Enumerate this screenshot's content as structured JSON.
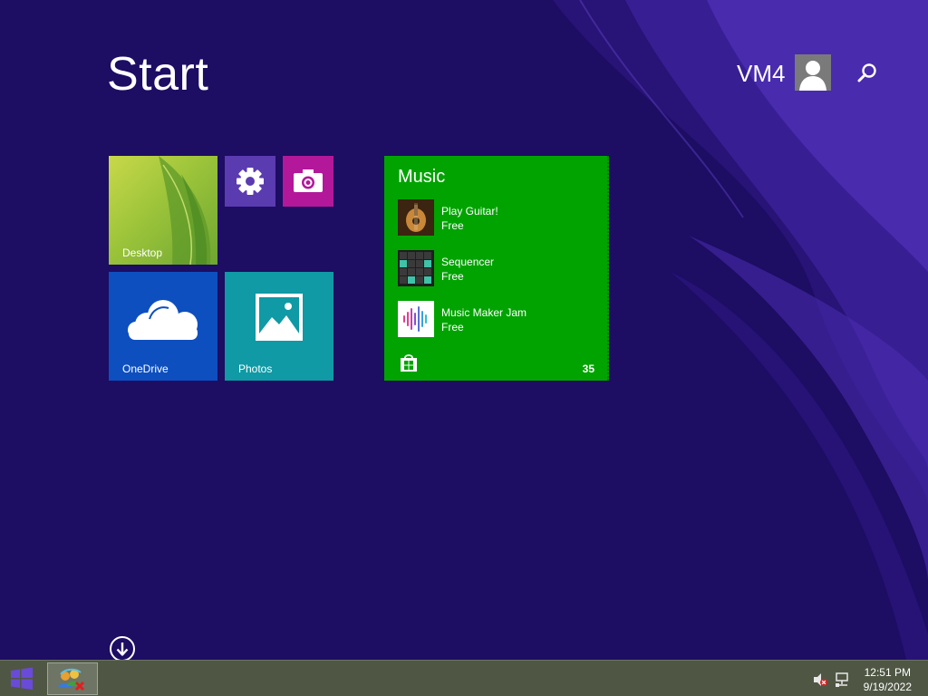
{
  "start": {
    "title": "Start"
  },
  "user": {
    "name": "VM4",
    "avatar_icon": "user-avatar-icon"
  },
  "search": {
    "icon": "search-icon"
  },
  "tiles": {
    "desktop": {
      "label": "Desktop"
    },
    "settings": {
      "icon": "gear-icon"
    },
    "camera": {
      "icon": "camera-icon"
    },
    "onedrive": {
      "label": "OneDrive",
      "icon": "cloud-icon"
    },
    "photos": {
      "label": "Photos",
      "icon": "photo-icon"
    },
    "music": {
      "title": "Music",
      "items": [
        {
          "name": "Play Guitar!",
          "price": "Free"
        },
        {
          "name": "Sequencer",
          "price": "Free"
        },
        {
          "name": "Music Maker Jam",
          "price": "Free"
        }
      ],
      "count": "35",
      "store_icon": "store-icon"
    }
  },
  "all_apps": {
    "icon": "arrow-down-circle-icon"
  },
  "taskbar": {
    "start_icon": "windows-logo-icon",
    "app_icon": "network-users-icon",
    "tray": {
      "volume_icon": "volume-muted-icon",
      "network_icon": "network-icon"
    },
    "clock": {
      "time": "12:51 PM",
      "date": "9/19/2022"
    }
  },
  "colors": {
    "background": "#1d0d63",
    "tile_music": "#00a300",
    "tile_onedrive": "#0d4fbf",
    "tile_photos": "#0f9aa5",
    "tile_settings": "#5b3bb0",
    "tile_camera": "#b3189a",
    "taskbar": "#4f5744"
  }
}
